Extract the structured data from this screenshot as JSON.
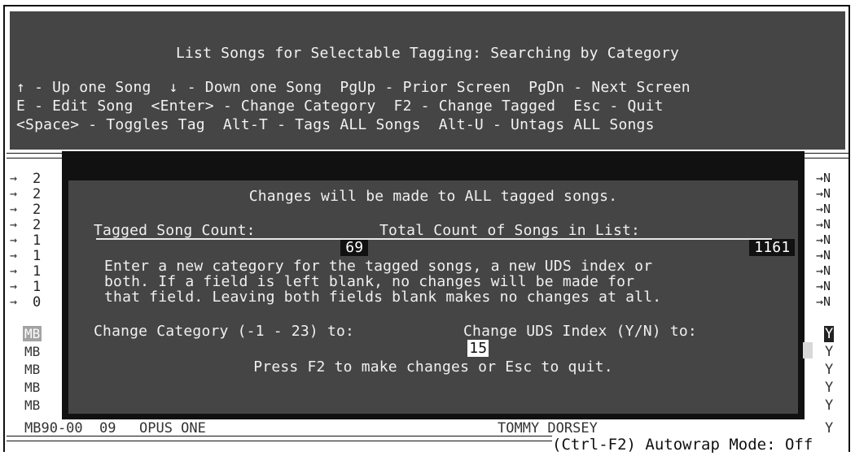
{
  "header": {
    "title": "List Songs for Selectable Tagging: Searching by Category",
    "help_lines": [
      "↑ - Up one Song  ↓ - Down one Song  PgUp - Prior Screen  PgDn - Next Screen",
      "E - Edit Song  <Enter> - Change Category  F2 - Change Tagged  Esc - Quit",
      "<Space> - Toggles Tag  Alt-T - Tags ALL Songs  Alt-U - Untags ALL Songs"
    ]
  },
  "list": {
    "arrow_rows": [
      {
        "arrow": "→",
        "digit": "2",
        "flag": "→N"
      },
      {
        "arrow": "→",
        "digit": "2",
        "flag": "→N"
      },
      {
        "arrow": "→",
        "digit": "2",
        "flag": "→N"
      },
      {
        "arrow": "→",
        "digit": "2",
        "flag": "→N"
      },
      {
        "arrow": "→",
        "digit": "1",
        "flag": "→N"
      },
      {
        "arrow": "→",
        "digit": "1",
        "flag": "→N"
      },
      {
        "arrow": "→",
        "digit": "1",
        "flag": "→N"
      },
      {
        "arrow": "→",
        "digit": "1",
        "flag": "→N"
      },
      {
        "arrow": "→",
        "digit": "0",
        "flag": "→N"
      }
    ],
    "mb_rows": [
      {
        "code": "MB",
        "flag": "Y"
      },
      {
        "code": "MB",
        "flag": "Y"
      },
      {
        "code": "MB",
        "flag": "Y"
      },
      {
        "code": "MB",
        "flag": "Y"
      },
      {
        "code": "MB",
        "flag": "Y"
      }
    ],
    "bottom_row": {
      "code": "MB90-00",
      "number": "09",
      "title": "OPUS ONE",
      "artist": "TOMMY DORSEY",
      "flag": "Y"
    }
  },
  "dialog": {
    "heading": "Changes will be made to ALL tagged songs.",
    "tagged_label": "Tagged Song Count:",
    "tagged_value": "69",
    "total_label": "Total Count of Songs in List:",
    "total_value": "1161",
    "instructions": [
      "Enter a new category for the tagged songs, a new UDS index or",
      "both. If a field is left blank, no changes will be made for",
      "that field. Leaving both fields blank makes no changes at all."
    ],
    "category_label": "Change Category (-1 - 23) to:",
    "category_value": "15",
    "uds_label": "Change UDS Index (Y/N) to:",
    "uds_value": "",
    "footer": "Press F2 to make changes or Esc to quit."
  },
  "status": {
    "autowrap": "(Ctrl-F2) Autowrap Mode: Off"
  }
}
